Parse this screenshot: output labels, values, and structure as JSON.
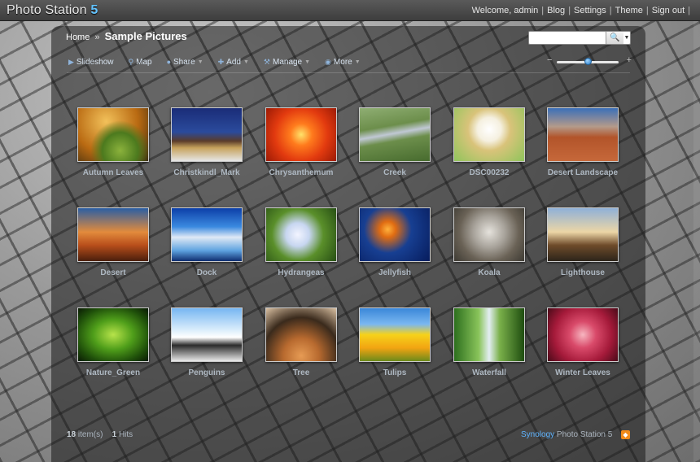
{
  "brand": {
    "name": "Photo Station",
    "version": "5"
  },
  "toplinks": {
    "welcome": "Welcome, admin",
    "blog": "Blog",
    "settings": "Settings",
    "theme": "Theme",
    "signout": "Sign out"
  },
  "breadcrumb": {
    "home": "Home",
    "separator": "»",
    "album": "Sample Pictures"
  },
  "search": {
    "placeholder": "",
    "value": ""
  },
  "toolbar": {
    "slideshow": "Slideshow",
    "map": "Map",
    "share": "Share",
    "add": "Add",
    "manage": "Manage",
    "more": "More"
  },
  "zoom": {
    "minus": "−",
    "plus": "+",
    "level": 0.5
  },
  "photos": [
    {
      "name": "Autumn Leaves"
    },
    {
      "name": "Christkindl_Mark"
    },
    {
      "name": "Chrysanthemum"
    },
    {
      "name": "Creek"
    },
    {
      "name": "DSC00232"
    },
    {
      "name": "Desert Landscape"
    },
    {
      "name": "Desert"
    },
    {
      "name": "Dock"
    },
    {
      "name": "Hydrangeas"
    },
    {
      "name": "Jellyfish"
    },
    {
      "name": "Koala"
    },
    {
      "name": "Lighthouse"
    },
    {
      "name": "Nature_Green"
    },
    {
      "name": "Penguins"
    },
    {
      "name": "Tree"
    },
    {
      "name": "Tulips"
    },
    {
      "name": "Waterfall"
    },
    {
      "name": "Winter Leaves"
    }
  ],
  "footer": {
    "items_count": "18",
    "items_label": "item(s)",
    "hits_count": "1",
    "hits_label": "Hits",
    "vendor": "Synology",
    "product": "Photo Station 5"
  },
  "colors": {
    "accent": "#5fb4ff",
    "rss": "#f28b1a"
  }
}
